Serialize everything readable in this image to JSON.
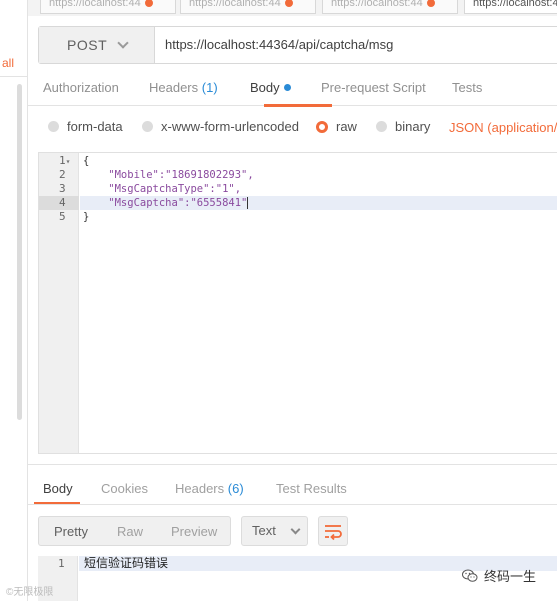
{
  "sidebar": {
    "partial_link": "all"
  },
  "request_tabs": [
    {
      "label": "https://localhost:44"
    },
    {
      "label": "https://localhost:44"
    },
    {
      "label": "https://localhost:44"
    },
    {
      "label": "https://localhost:44"
    }
  ],
  "request": {
    "method": "POST",
    "url": "https://localhost:44364/api/captcha/msg"
  },
  "config_tabs": {
    "authorization": "Authorization",
    "headers": "Headers",
    "headers_count": "(1)",
    "body": "Body",
    "prerequest": "Pre-request Script",
    "tests": "Tests"
  },
  "body_types": {
    "form_data": "form-data",
    "urlencoded": "x-www-form-urlencoded",
    "raw": "raw",
    "binary": "binary",
    "content_type": "JSON (application/js"
  },
  "editor": {
    "line_numbers": [
      "1",
      "2",
      "3",
      "4",
      "5"
    ],
    "lines": [
      "{",
      "    \"Mobile\":\"18691802293\",",
      "    \"MsgCaptchaType\":\"1\",",
      "    \"MsgCaptcha\":\"6555841\"",
      "}"
    ]
  },
  "response_tabs": {
    "body": "Body",
    "cookies": "Cookies",
    "headers": "Headers",
    "headers_count": "(6)",
    "test_results": "Test Results"
  },
  "response_view": {
    "pretty": "Pretty",
    "raw": "Raw",
    "preview": "Preview",
    "format": "Text"
  },
  "response_body": {
    "line_number": "1",
    "text": "短信验证码错误"
  },
  "watermarks": {
    "left": "©无限极限",
    "right": "终码一生"
  },
  "colors": {
    "accent": "#f26b3a",
    "link_blue": "#2a8bd6",
    "json_key": "#8a4a9e"
  }
}
